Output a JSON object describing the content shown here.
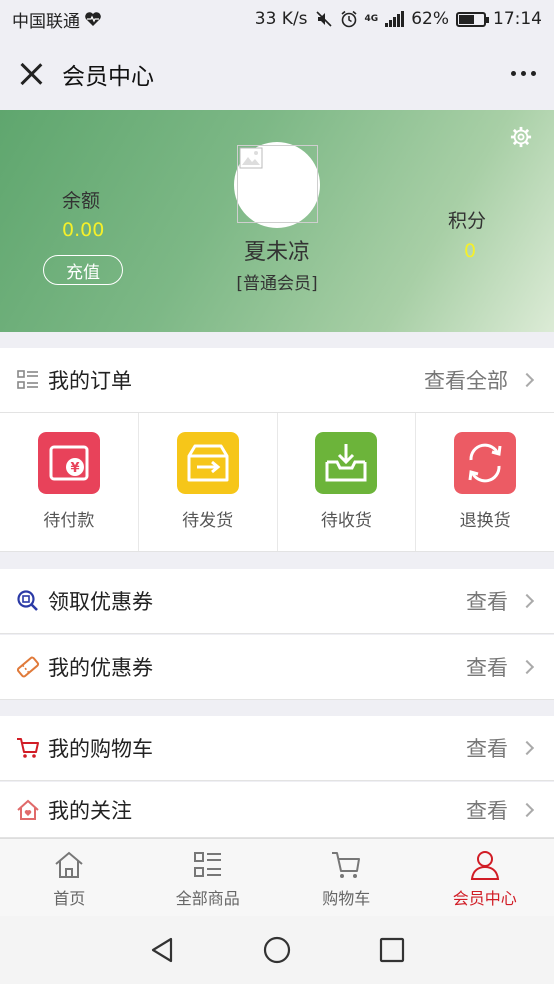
{
  "status": {
    "carrier": "中国联通",
    "speed": "33 K/s",
    "network": "4G",
    "battery": "62%",
    "battery_level": 0.62,
    "time": "17:14"
  },
  "nav": {
    "title": "会员中心"
  },
  "profile": {
    "balance_label": "余额",
    "balance_value": "0.00",
    "recharge_label": "充值",
    "name": "夏未凉",
    "level": "[普通会员]",
    "points_label": "积分",
    "points_value": "0"
  },
  "orders": {
    "title": "我的订单",
    "view_all": "查看全部",
    "items": [
      {
        "label": "待付款",
        "color": "#e8425a",
        "icon": "wallet-yen-icon"
      },
      {
        "label": "待发货",
        "color": "#f6c619",
        "icon": "box-arrow-icon"
      },
      {
        "label": "待收货",
        "color": "#6cb43a",
        "icon": "inbox-download-icon"
      },
      {
        "label": "退换货",
        "color": "#ec5b64",
        "icon": "refresh-icon"
      }
    ]
  },
  "menu": [
    {
      "label": "领取优惠券",
      "action": "查看",
      "icon": "coupon-search-icon"
    },
    {
      "label": "我的优惠券",
      "action": "查看",
      "icon": "ticket-icon"
    },
    {
      "label": "我的购物车",
      "action": "查看",
      "icon": "cart-icon"
    },
    {
      "label": "我的关注",
      "action": "查看",
      "icon": "home-heart-icon"
    }
  ],
  "tabs": [
    {
      "label": "首页",
      "icon": "home-icon"
    },
    {
      "label": "全部商品",
      "icon": "list-icon"
    },
    {
      "label": "购物车",
      "icon": "cart-icon"
    },
    {
      "label": "会员中心",
      "icon": "user-icon",
      "active": true
    }
  ],
  "colors": {
    "accent": "#d11d26",
    "balance": "#f5f02a",
    "banner": "#7db886"
  }
}
